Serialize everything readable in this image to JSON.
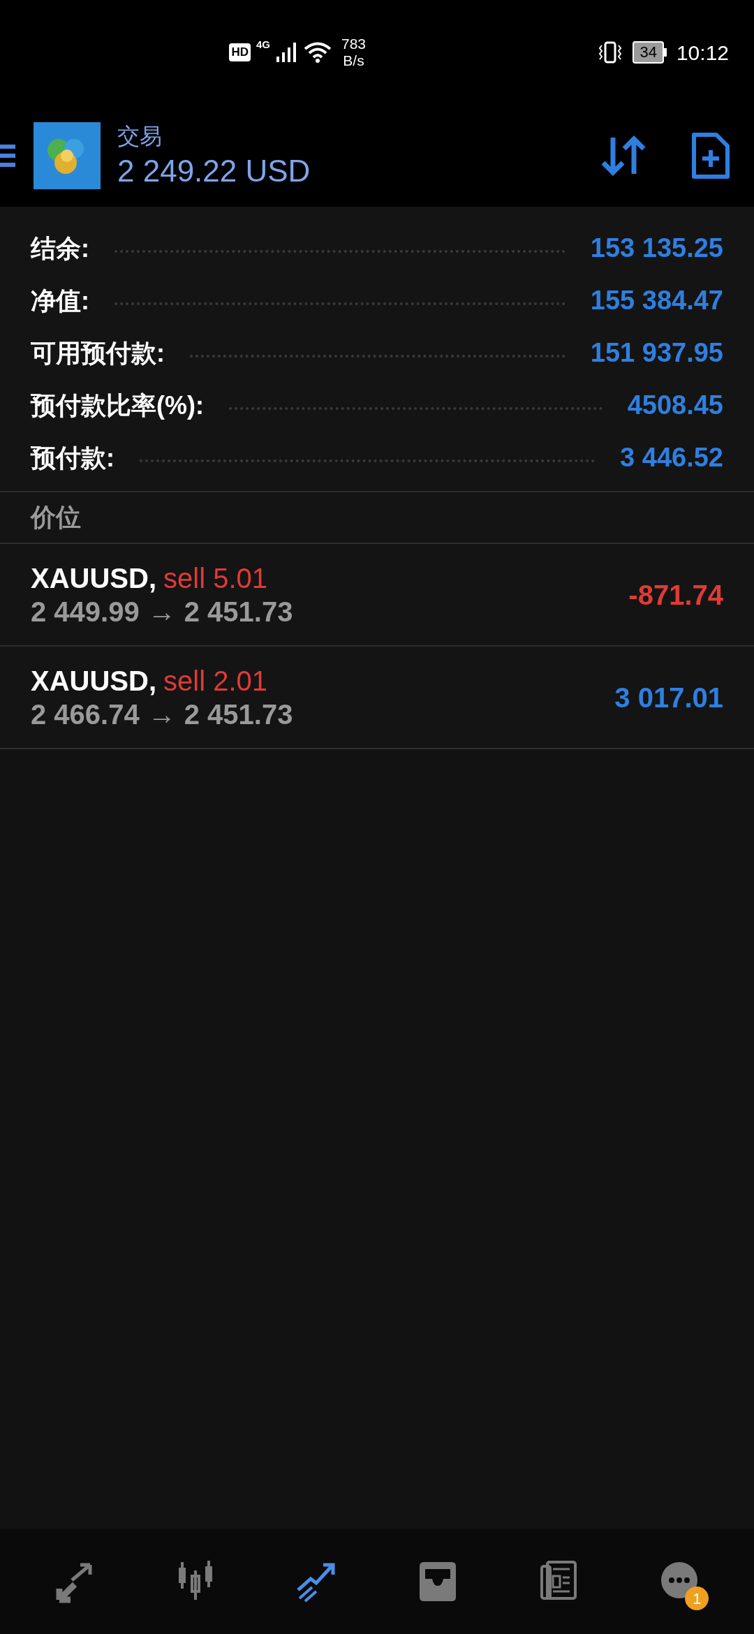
{
  "status_bar": {
    "hd": "HD",
    "network": "4G",
    "speed": "783",
    "speed_unit": "B/s",
    "battery": "34",
    "time": "10:12"
  },
  "header": {
    "title": "交易",
    "balance": "2 249.22 USD"
  },
  "summary": [
    {
      "label": "结余:",
      "value": "153 135.25"
    },
    {
      "label": "净值:",
      "value": "155 384.47"
    },
    {
      "label": "可用预付款:",
      "value": "151 937.95"
    },
    {
      "label": "预付款比率(%):",
      "value": "4508.45"
    },
    {
      "label": "预付款:",
      "value": "3 446.52"
    }
  ],
  "section_title": "价位",
  "positions": [
    {
      "symbol": "XAUUSD,",
      "side": "sell 5.01",
      "open_price": "2 449.99",
      "arrow": "→",
      "current_price": "2 451.73",
      "profit": "-871.74",
      "loss": true
    },
    {
      "symbol": "XAUUSD,",
      "side": "sell 2.01",
      "open_price": "2 466.74",
      "arrow": "→",
      "current_price": "2 451.73",
      "profit": "3 017.01",
      "loss": false
    }
  ],
  "bottom_nav": [
    {
      "kind": "trade",
      "selected": false
    },
    {
      "kind": "quotes",
      "selected": false
    },
    {
      "kind": "chart",
      "selected": true
    },
    {
      "kind": "inbox",
      "selected": false
    },
    {
      "kind": "news",
      "selected": false
    },
    {
      "kind": "chat",
      "selected": false,
      "badge": "1"
    }
  ]
}
